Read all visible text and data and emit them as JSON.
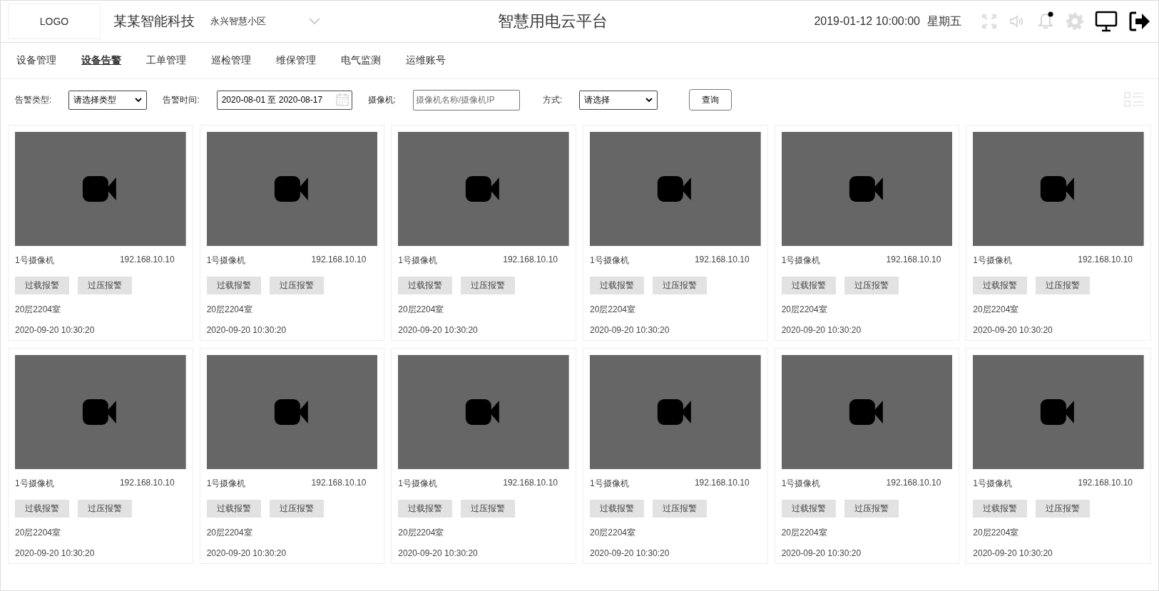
{
  "header": {
    "logo": "LOGO",
    "company": "某某智能科技",
    "community": "永兴智慧小区",
    "title": "智慧用电云平台",
    "datetime": "2019-01-12 10:00:00",
    "weekday": "星期五",
    "unread": true
  },
  "nav": [
    {
      "label": "设备管理",
      "selected": false
    },
    {
      "label": "设备告警",
      "selected": true
    },
    {
      "label": "工单管理",
      "selected": false
    },
    {
      "label": "巡检管理",
      "selected": false
    },
    {
      "label": "维保管理",
      "selected": false
    },
    {
      "label": "电气监测",
      "selected": false
    },
    {
      "label": "运维账号",
      "selected": false
    }
  ],
  "filters": {
    "type_label": "告警类型:",
    "type_value": "请选择类型",
    "time_label": "告警时间:",
    "time_value": "2020-08-01 至 2020-08-17",
    "camera_label": "摄像机:",
    "camera_placeholder": "摄像机名称/摄像机IP",
    "mode_label": "方式:",
    "mode_value": "请选择",
    "query": "查询"
  },
  "cameras": [
    {
      "name": "1号摄像机",
      "ip": "192.168.10.10",
      "tags": [
        "过载报警",
        "过压报警"
      ],
      "location": "20层2204室",
      "time": "2020-09-20 10:30:20"
    },
    {
      "name": "1号摄像机",
      "ip": "192.168.10.10",
      "tags": [
        "过载报警",
        "过压报警"
      ],
      "location": "20层2204室",
      "time": "2020-09-20 10:30:20"
    },
    {
      "name": "1号摄像机",
      "ip": "192.168.10.10",
      "tags": [
        "过载报警",
        "过压报警"
      ],
      "location": "20层2204室",
      "time": "2020-09-20 10:30:20"
    },
    {
      "name": "1号摄像机",
      "ip": "192.168.10.10",
      "tags": [
        "过载报警",
        "过压报警"
      ],
      "location": "20层2204室",
      "time": "2020-09-20 10:30:20"
    },
    {
      "name": "1号摄像机",
      "ip": "192.168.10.10",
      "tags": [
        "过载报警",
        "过压报警"
      ],
      "location": "20层2204室",
      "time": "2020-09-20 10:30:20"
    },
    {
      "name": "1号摄像机",
      "ip": "192.168.10.10",
      "tags": [
        "过载报警",
        "过压报警"
      ],
      "location": "20层2204室",
      "time": "2020-09-20 10:30:20"
    },
    {
      "name": "1号摄像机",
      "ip": "192.168.10.10",
      "tags": [
        "过载报警",
        "过压报警"
      ],
      "location": "20层2204室",
      "time": "2020-09-20 10:30:20"
    },
    {
      "name": "1号摄像机",
      "ip": "192.168.10.10",
      "tags": [
        "过载报警",
        "过压报警"
      ],
      "location": "20层2204室",
      "time": "2020-09-20 10:30:20"
    },
    {
      "name": "1号摄像机",
      "ip": "192.168.10.10",
      "tags": [
        "过载报警",
        "过压报警"
      ],
      "location": "20层2204室",
      "time": "2020-09-20 10:30:20"
    },
    {
      "name": "1号摄像机",
      "ip": "192.168.10.10",
      "tags": [
        "过载报警",
        "过压报警"
      ],
      "location": "20层2204室",
      "time": "2020-09-20 10:30:20"
    },
    {
      "name": "1号摄像机",
      "ip": "192.168.10.10",
      "tags": [
        "过载报警",
        "过压报警"
      ],
      "location": "20层2204室",
      "time": "2020-09-20 10:30:20"
    },
    {
      "name": "1号摄像机",
      "ip": "192.168.10.10",
      "tags": [
        "过载报警",
        "过压报警"
      ],
      "location": "20层2204室",
      "time": "2020-09-20 10:30:20"
    }
  ]
}
